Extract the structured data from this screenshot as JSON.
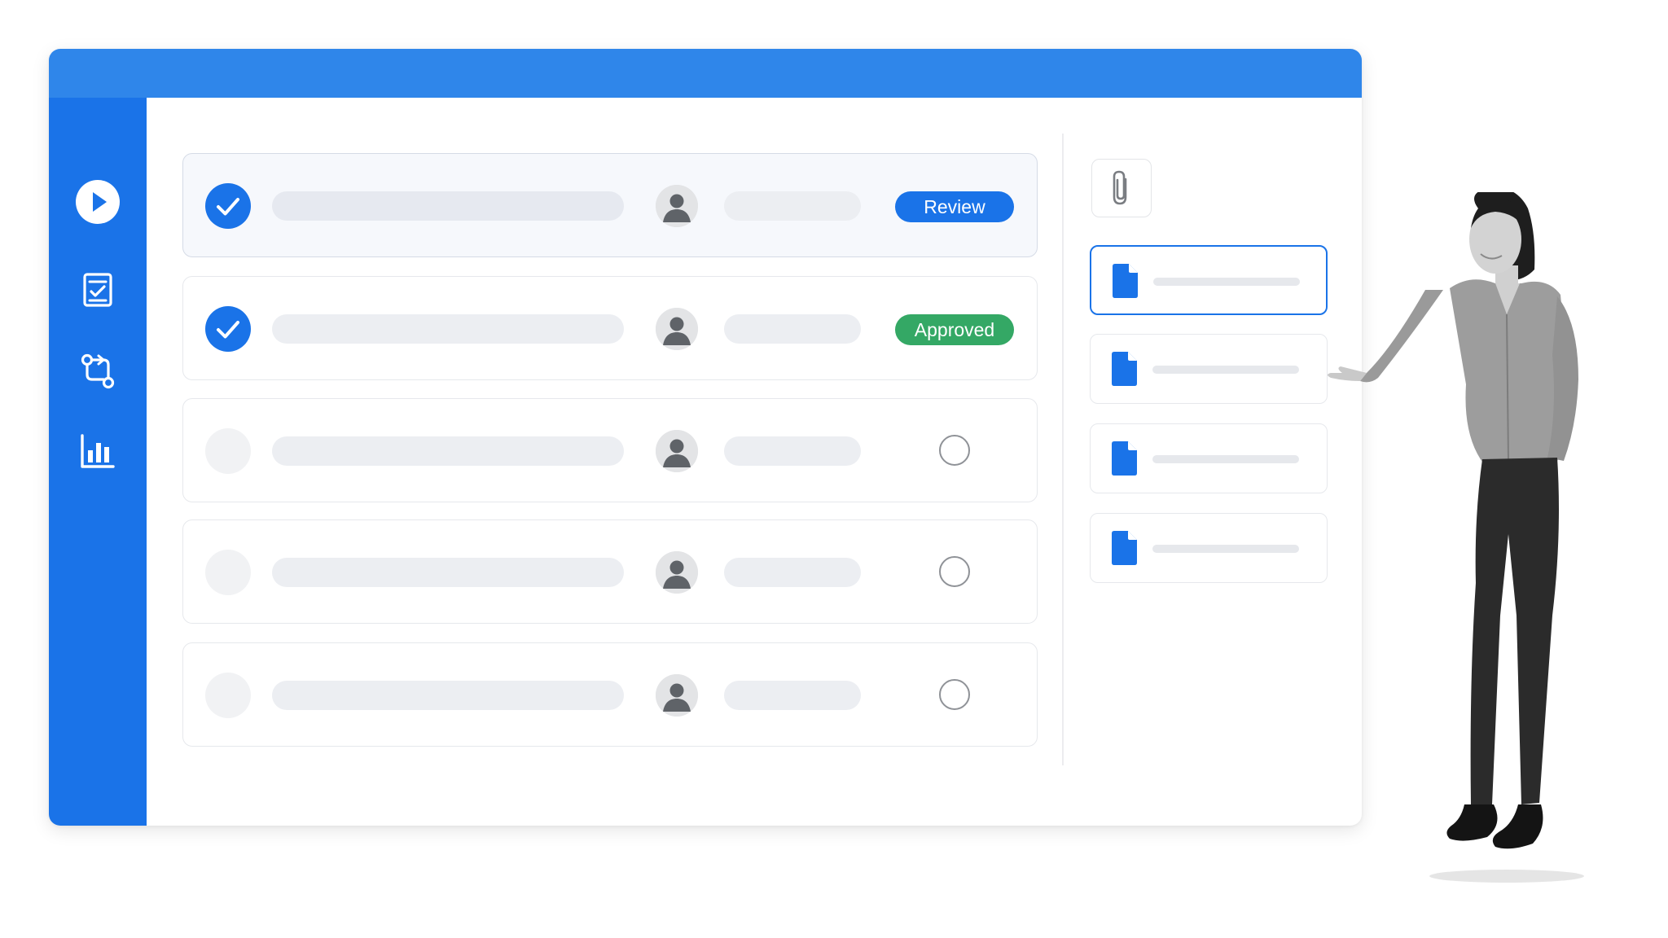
{
  "colors": {
    "accent": "#1a73e8",
    "topbar": "#2f86ea",
    "approved": "#34a865",
    "placeholder": "#eceef2"
  },
  "sidebar": {
    "items": [
      {
        "icon": "play-circle-icon"
      },
      {
        "icon": "checklist-icon"
      },
      {
        "icon": "workflow-icon"
      },
      {
        "icon": "bar-chart-icon"
      }
    ]
  },
  "tasks": [
    {
      "checked": true,
      "status": "Review"
    },
    {
      "checked": true,
      "status": "Approved"
    },
    {
      "checked": false,
      "status": ""
    },
    {
      "checked": false,
      "status": ""
    },
    {
      "checked": false,
      "status": ""
    }
  ],
  "attachments": {
    "button_icon": "paperclip-icon",
    "files": [
      {
        "icon": "document-icon",
        "selected": true
      },
      {
        "icon": "document-icon",
        "selected": false
      },
      {
        "icon": "document-icon",
        "selected": false
      },
      {
        "icon": "document-icon",
        "selected": false
      }
    ]
  }
}
